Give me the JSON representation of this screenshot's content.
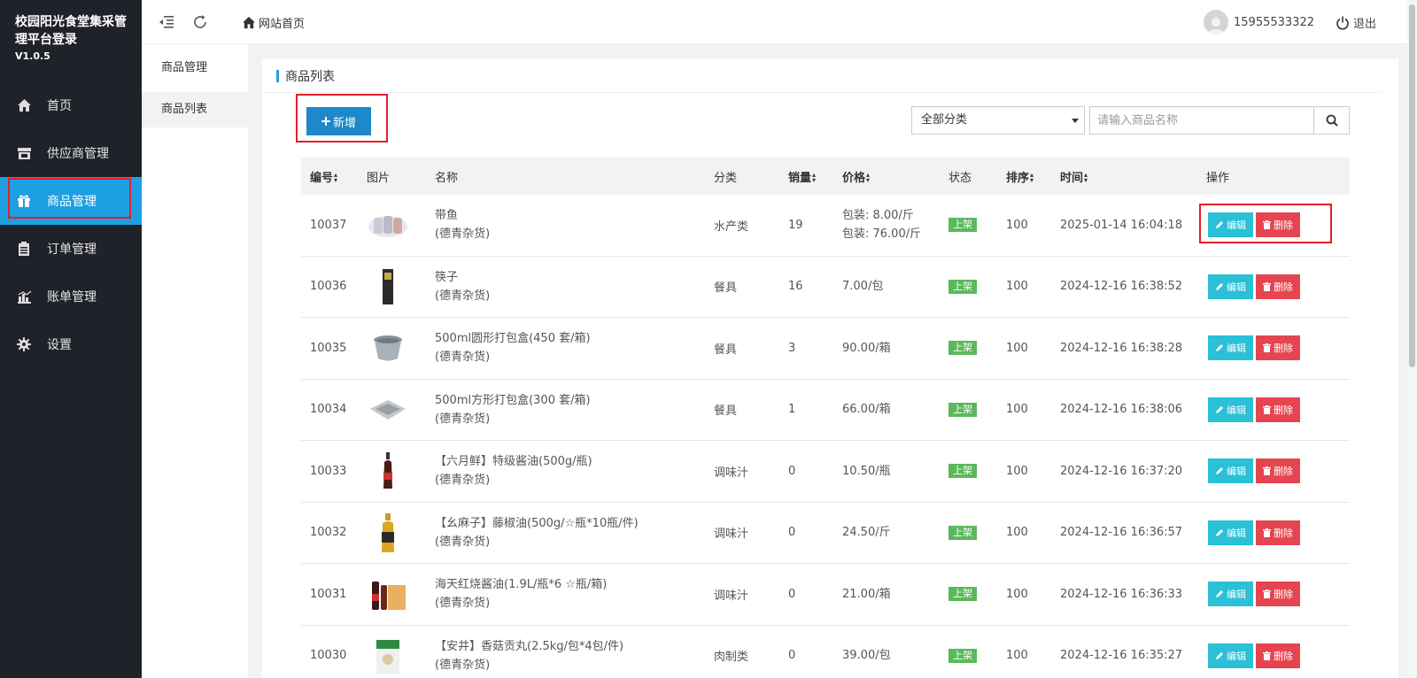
{
  "brand": {
    "title": "校园阳光食堂集采管理平台登录",
    "version": "V1.0.5"
  },
  "sidebar": {
    "items": [
      {
        "label": "首页",
        "icon": "home-icon"
      },
      {
        "label": "供应商管理",
        "icon": "store-icon"
      },
      {
        "label": "商品管理",
        "icon": "gift-icon",
        "active": true
      },
      {
        "label": "订单管理",
        "icon": "clipboard-icon"
      },
      {
        "label": "账单管理",
        "icon": "chart-icon"
      },
      {
        "label": "设置",
        "icon": "gear-icon"
      }
    ]
  },
  "topbar": {
    "home_link": "网站首页",
    "username": "15955533322",
    "logout": "退出"
  },
  "subnav": {
    "heading": "商品管理",
    "item": "商品列表"
  },
  "panel": {
    "title": "商品列表",
    "add_button": "新增",
    "category_select": "全部分类",
    "search_placeholder": "请输入商品名称"
  },
  "table": {
    "headers": {
      "id": "编号",
      "image": "图片",
      "name": "名称",
      "category": "分类",
      "sales": "销量",
      "price": "价格",
      "status": "状态",
      "sort": "排序",
      "time": "时间",
      "actions": "操作"
    },
    "edit_label": "编辑",
    "delete_label": "删除",
    "rows": [
      {
        "id": "10037",
        "name": "带鱼",
        "supplier": "(德青杂货)",
        "category": "水产类",
        "sales": "19",
        "price1": "包装: 8.00/斤",
        "price2": "包装: 76.00/斤",
        "status": "上架",
        "sort": "100",
        "time": "2025-01-14 16:04:18",
        "thumb": "fish"
      },
      {
        "id": "10036",
        "name": "筷子",
        "supplier": "(德青杂货)",
        "category": "餐具",
        "sales": "16",
        "price1": "7.00/包",
        "price2": "",
        "status": "上架",
        "sort": "100",
        "time": "2024-12-16 16:38:52",
        "thumb": "chopsticks"
      },
      {
        "id": "10035",
        "name": "500ml圆形打包盒(450 套/箱)",
        "supplier": "(德青杂货)",
        "category": "餐具",
        "sales": "3",
        "price1": "90.00/箱",
        "price2": "",
        "status": "上架",
        "sort": "100",
        "time": "2024-12-16 16:38:28",
        "thumb": "bowl"
      },
      {
        "id": "10034",
        "name": "500ml方形打包盒(300 套/箱)",
        "supplier": "(德青杂货)",
        "category": "餐具",
        "sales": "1",
        "price1": "66.00/箱",
        "price2": "",
        "status": "上架",
        "sort": "100",
        "time": "2024-12-16 16:38:06",
        "thumb": "box"
      },
      {
        "id": "10033",
        "name": "【六月鲜】特级酱油(500g/瓶)",
        "supplier": "(德青杂货)",
        "category": "调味汁",
        "sales": "0",
        "price1": "10.50/瓶",
        "price2": "",
        "status": "上架",
        "sort": "100",
        "time": "2024-12-16 16:37:20",
        "thumb": "soy"
      },
      {
        "id": "10032",
        "name": "【幺麻子】藤椒油(500g/☆瓶*10瓶/件)",
        "supplier": "(德青杂货)",
        "category": "调味汁",
        "sales": "0",
        "price1": "24.50/斤",
        "price2": "",
        "status": "上架",
        "sort": "100",
        "time": "2024-12-16 16:36:57",
        "thumb": "oil"
      },
      {
        "id": "10031",
        "name": "海天红烧酱油(1.9L/瓶*6 ☆瓶/箱)",
        "supplier": "(德青杂货)",
        "category": "调味汁",
        "sales": "0",
        "price1": "21.00/箱",
        "price2": "",
        "status": "上架",
        "sort": "100",
        "time": "2024-12-16 16:36:33",
        "thumb": "bottles"
      },
      {
        "id": "10030",
        "name": "【安井】香菇贡丸(2.5kg/包*4包/件)",
        "supplier": "(德青杂货)",
        "category": "肉制类",
        "sales": "0",
        "price1": "39.00/包",
        "price2": "",
        "status": "上架",
        "sort": "100",
        "time": "2024-12-16 16:35:27",
        "thumb": "bag"
      }
    ]
  }
}
